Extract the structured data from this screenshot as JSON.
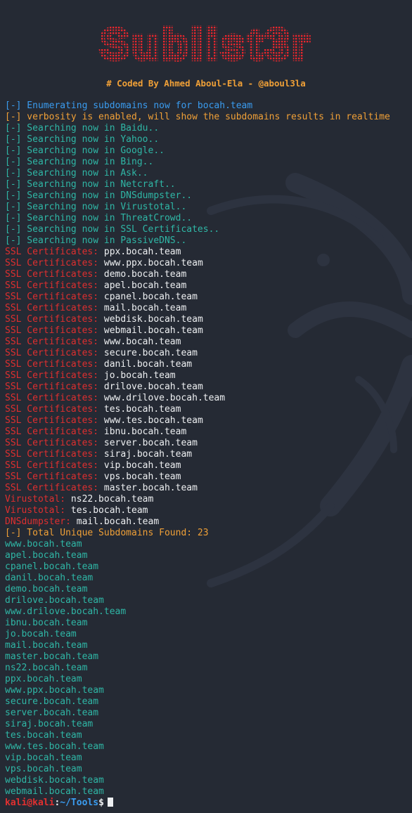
{
  "banner": {
    "title": "Sublist3r",
    "credit": "# Coded By Ahmed Aboul-Ela - @aboul3la"
  },
  "colors": {
    "background": "#252a34",
    "banner": "#e8262c",
    "info_blue": "#3a9cf0",
    "warn_orange": "#f0a037",
    "search_teal": "#2fb7a6",
    "engine_red": "#df2f2f",
    "text_white": "#eef0f2"
  },
  "messages": {
    "enumerating": "[-] Enumerating subdomains now for bocah.team",
    "verbosity": "[-] verbosity is enabled, will show the subdomains results in realtime",
    "total": "[-] Total Unique Subdomains Found: 23"
  },
  "searches": [
    "[-] Searching now in Baidu..",
    "[-] Searching now in Yahoo..",
    "[-] Searching now in Google..",
    "[-] Searching now in Bing..",
    "[-] Searching now in Ask..",
    "[-] Searching now in Netcraft..",
    "[-] Searching now in DNSdumpster..",
    "[-] Searching now in Virustotal..",
    "[-] Searching now in ThreatCrowd..",
    "[-] Searching now in SSL Certificates..",
    "[-] Searching now in PassiveDNS.."
  ],
  "realtime_results": [
    {
      "engine": "SSL Certificates:",
      "host": "ppx.bocah.team"
    },
    {
      "engine": "SSL Certificates:",
      "host": "www.ppx.bocah.team"
    },
    {
      "engine": "SSL Certificates:",
      "host": "demo.bocah.team"
    },
    {
      "engine": "SSL Certificates:",
      "host": "apel.bocah.team"
    },
    {
      "engine": "SSL Certificates:",
      "host": "cpanel.bocah.team"
    },
    {
      "engine": "SSL Certificates:",
      "host": "mail.bocah.team"
    },
    {
      "engine": "SSL Certificates:",
      "host": "webdisk.bocah.team"
    },
    {
      "engine": "SSL Certificates:",
      "host": "webmail.bocah.team"
    },
    {
      "engine": "SSL Certificates:",
      "host": "www.bocah.team"
    },
    {
      "engine": "SSL Certificates:",
      "host": "secure.bocah.team"
    },
    {
      "engine": "SSL Certificates:",
      "host": "danil.bocah.team"
    },
    {
      "engine": "SSL Certificates:",
      "host": "jo.bocah.team"
    },
    {
      "engine": "SSL Certificates:",
      "host": "drilove.bocah.team"
    },
    {
      "engine": "SSL Certificates:",
      "host": "www.drilove.bocah.team"
    },
    {
      "engine": "SSL Certificates:",
      "host": "tes.bocah.team"
    },
    {
      "engine": "SSL Certificates:",
      "host": "www.tes.bocah.team"
    },
    {
      "engine": "SSL Certificates:",
      "host": "ibnu.bocah.team"
    },
    {
      "engine": "SSL Certificates:",
      "host": "server.bocah.team"
    },
    {
      "engine": "SSL Certificates:",
      "host": "siraj.bocah.team"
    },
    {
      "engine": "SSL Certificates:",
      "host": "vip.bocah.team"
    },
    {
      "engine": "SSL Certificates:",
      "host": "vps.bocah.team"
    },
    {
      "engine": "SSL Certificates:",
      "host": "master.bocah.team"
    },
    {
      "engine": "Virustotal:",
      "host": "ns22.bocah.team"
    },
    {
      "engine": "Virustotal:",
      "host": "tes.bocah.team"
    },
    {
      "engine": "DNSdumpster:",
      "host": "mail.bocah.team"
    }
  ],
  "unique_subdomains": [
    "www.bocah.team",
    "apel.bocah.team",
    "cpanel.bocah.team",
    "danil.bocah.team",
    "demo.bocah.team",
    "drilove.bocah.team",
    "www.drilove.bocah.team",
    "ibnu.bocah.team",
    "jo.bocah.team",
    "mail.bocah.team",
    "master.bocah.team",
    "ns22.bocah.team",
    "ppx.bocah.team",
    "www.ppx.bocah.team",
    "secure.bocah.team",
    "server.bocah.team",
    "siraj.bocah.team",
    "tes.bocah.team",
    "www.tes.bocah.team",
    "vip.bocah.team",
    "vps.bocah.team",
    "webdisk.bocah.team",
    "webmail.bocah.team"
  ],
  "prompt": {
    "user": "kali@kali",
    "separator": ":",
    "path": "~/Tools",
    "symbol": "$"
  }
}
